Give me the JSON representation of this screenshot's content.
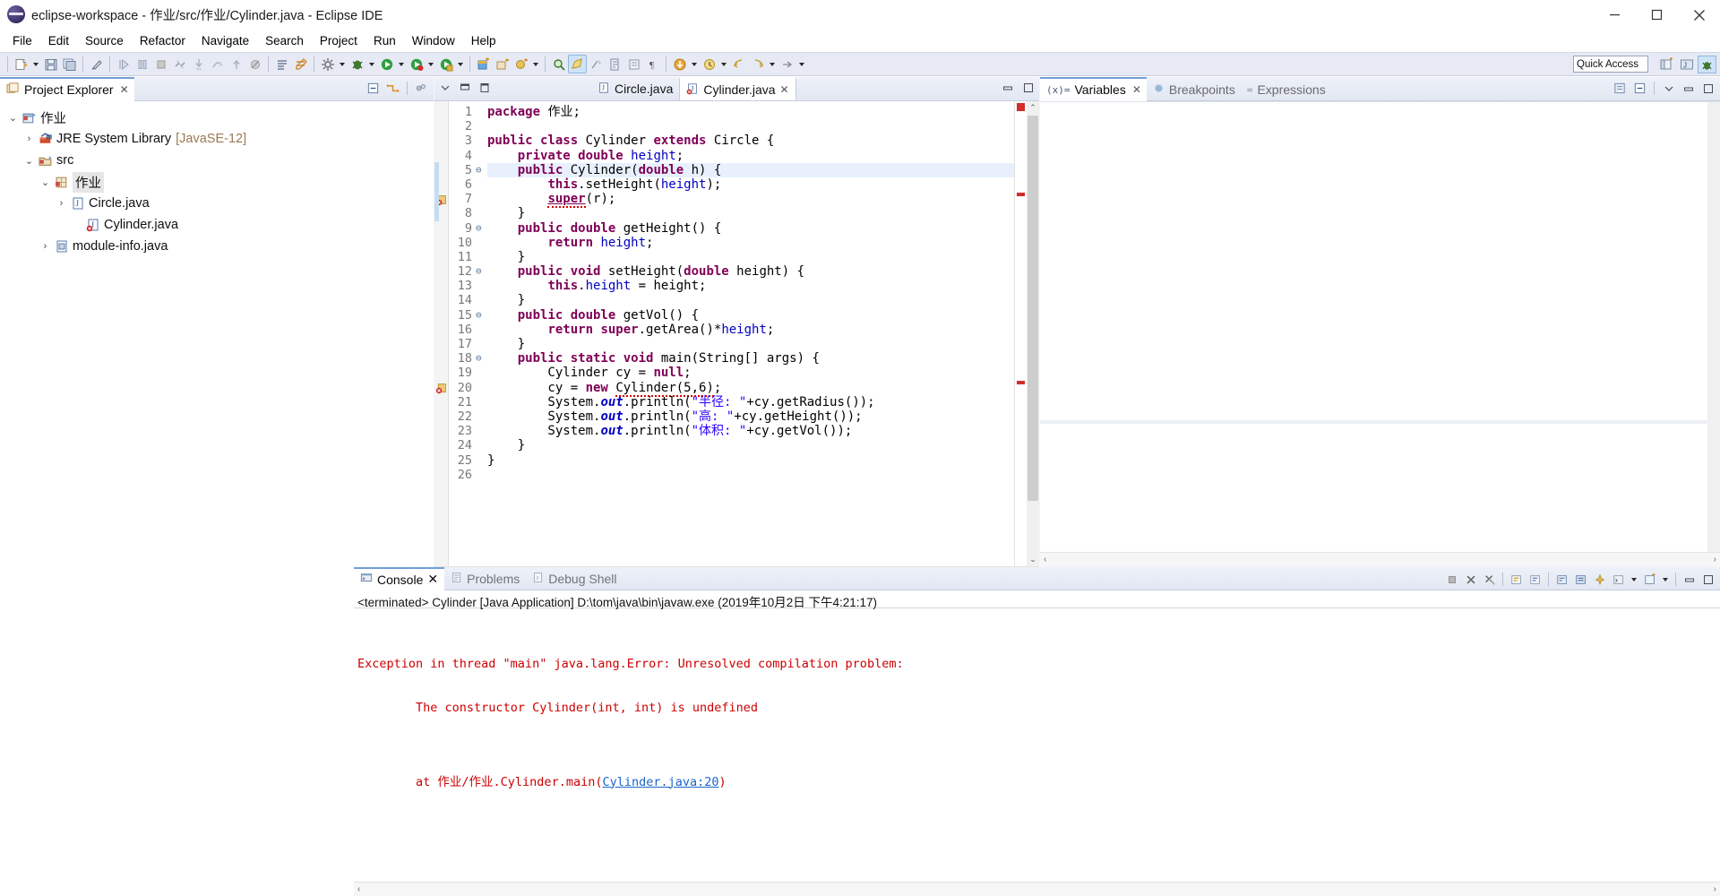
{
  "window": {
    "title": "eclipse-workspace - 作业/src/作业/Cylinder.java - Eclipse IDE",
    "app_icon": "eclipse-icon",
    "minimize_label": "–",
    "maximize_label": "□",
    "close_label": "✕"
  },
  "menubar": {
    "items": [
      {
        "label": "File"
      },
      {
        "label": "Edit"
      },
      {
        "label": "Source"
      },
      {
        "label": "Refactor"
      },
      {
        "label": "Navigate"
      },
      {
        "label": "Search"
      },
      {
        "label": "Project"
      },
      {
        "label": "Run"
      },
      {
        "label": "Window"
      },
      {
        "label": "Help"
      }
    ]
  },
  "toolbar": {
    "quick_access_value": "Quick Access",
    "icons": [
      "new-wizard-icon",
      "save-icon",
      "save-all-icon",
      "link-icon",
      "skip-breakpoints-icon",
      "resume-icon",
      "suspend-icon",
      "terminate-icon",
      "disconnect-icon",
      "step-into-icon",
      "step-over-icon",
      "step-return-icon",
      "toggle-mark-occurrences-icon",
      "open-type-icon",
      "external-tools-icon",
      "run-icon",
      "debug-icon",
      "run-last-icon",
      "new-java-project-icon",
      "new-package-icon",
      "new-class-icon",
      "search-icon",
      "java-perspective-icon",
      "annotation-icon",
      "previous-annotation-icon",
      "next-annotation-icon",
      "pilcrow-icon",
      "back-icon",
      "forward-icon",
      "last-edit-icon",
      "previous-edit-icon"
    ],
    "perspective_buttons": [
      "open-perspective-icon",
      "java-perspective-icon",
      "debug-perspective-icon"
    ]
  },
  "project_explorer": {
    "tab_label": "Project Explorer",
    "tab_icon": "project-explorer-icon",
    "close_icon": "✕",
    "tools": [
      "collapse-all-icon",
      "link-with-editor-icon",
      "view-menu-icon"
    ],
    "tree": [
      {
        "label": "作业",
        "icon": "java-project-icon",
        "twist": "⌄",
        "indent": 0,
        "decoration": "",
        "selected": false
      },
      {
        "label": "JRE System Library",
        "icon": "jre-library-icon",
        "twist": "›",
        "indent": 1,
        "decoration": "[JavaSE-12]",
        "selected": false
      },
      {
        "label": "src",
        "icon": "source-folder-icon",
        "twist": "⌄",
        "indent": 1,
        "decoration": "",
        "selected": false
      },
      {
        "label": "作业",
        "icon": "package-icon",
        "twist": "⌄",
        "indent": 2,
        "decoration": "",
        "selected": true
      },
      {
        "label": "Circle.java",
        "icon": "java-file-icon",
        "twist": "›",
        "indent": 3,
        "decoration": "",
        "selected": false
      },
      {
        "label": "Cylinder.java",
        "icon": "java-file-error-icon",
        "twist": "",
        "indent": 3,
        "decoration": "",
        "selected": false
      },
      {
        "label": "module-info.java",
        "icon": "java-module-icon",
        "twist": "›",
        "indent": 2,
        "decoration": "",
        "selected": false
      }
    ]
  },
  "editor": {
    "tools": [
      "view-menu-icon",
      "minimize-icon",
      "maximize-icon"
    ],
    "tabs": [
      {
        "label": "Circle.java",
        "icon": "java-file-icon",
        "active": false,
        "close_icon": ""
      },
      {
        "label": "Cylinder.java",
        "icon": "java-file-error-icon",
        "active": true,
        "close_icon": "✕"
      }
    ],
    "minimize_icon": "minimize-icon",
    "maximize_icon": "maximize-icon",
    "current_line": 5,
    "error_lines": [
      7,
      20
    ],
    "lines": [
      {
        "n": "1",
        "fold": "",
        "html": "<span class=\"k\">package</span> 作业;"
      },
      {
        "n": "2",
        "fold": "",
        "html": ""
      },
      {
        "n": "3",
        "fold": "",
        "html": "<span class=\"k\">public class</span> Cylinder <span class=\"k\">extends</span> Circle {"
      },
      {
        "n": "4",
        "fold": "",
        "html": "    <span class=\"k\">private double</span> <span class=\"f\">height</span>;"
      },
      {
        "n": "5",
        "fold": "⊖",
        "html": "    <span class=\"k\">public</span> Cylinder(<span class=\"k\">double</span> h) {"
      },
      {
        "n": "6",
        "fold": "",
        "html": "        <span class=\"k\">this</span>.setHeight(<span class=\"f\">height</span>);"
      },
      {
        "n": "7",
        "fold": "",
        "html": "        <span class=\"sup err-squig\">super</span>(r);"
      },
      {
        "n": "8",
        "fold": "",
        "html": "    }"
      },
      {
        "n": "9",
        "fold": "⊖",
        "html": "    <span class=\"k\">public double</span> getHeight() {"
      },
      {
        "n": "10",
        "fold": "",
        "html": "        <span class=\"k\">return</span> <span class=\"f\">height</span>;"
      },
      {
        "n": "11",
        "fold": "",
        "html": "    }"
      },
      {
        "n": "12",
        "fold": "⊖",
        "html": "    <span class=\"k\">public void</span> setHeight(<span class=\"k\">double</span> height) {"
      },
      {
        "n": "13",
        "fold": "",
        "html": "        <span class=\"k\">this</span>.<span class=\"f\">height</span> = height;"
      },
      {
        "n": "14",
        "fold": "",
        "html": "    }"
      },
      {
        "n": "15",
        "fold": "⊖",
        "html": "    <span class=\"k\">public double</span> getVol() {"
      },
      {
        "n": "16",
        "fold": "",
        "html": "        <span class=\"k\">return super</span>.getArea()*<span class=\"f\">height</span>;"
      },
      {
        "n": "17",
        "fold": "",
        "html": "    }"
      },
      {
        "n": "18",
        "fold": "⊖",
        "html": "    <span class=\"k\">public static void</span> main(String[] args) {"
      },
      {
        "n": "19",
        "fold": "",
        "html": "        Cylinder cy = <span class=\"k\">null</span>;"
      },
      {
        "n": "20",
        "fold": "",
        "html": "        cy = <span class=\"k\">new</span> <span class=\"err-squig\">Cylinder(5,6)</span>;"
      },
      {
        "n": "21",
        "fold": "",
        "html": "        System.<span class=\"st\">out</span>.println(<span class=\"s\">\"半径: \"</span>+cy.getRadius());"
      },
      {
        "n": "22",
        "fold": "",
        "html": "        System.<span class=\"st\">out</span>.println(<span class=\"s\">\"高: \"</span>+cy.getHeight());"
      },
      {
        "n": "23",
        "fold": "",
        "html": "        System.<span class=\"st\">out</span>.println(<span class=\"s\">\"体积: \"</span>+cy.getVol());"
      },
      {
        "n": "24",
        "fold": "",
        "html": "    }"
      },
      {
        "n": "25",
        "fold": "",
        "html": "}"
      },
      {
        "n": "26",
        "fold": "",
        "html": ""
      }
    ],
    "scroll_up": "⌃",
    "scroll_down": "⌄",
    "hscroll_left": "‹",
    "hscroll_right": "›"
  },
  "debug_views": {
    "tabs": [
      {
        "label": "Variables",
        "icon": "variables-icon",
        "active": true,
        "close_icon": "✕"
      },
      {
        "label": "Breakpoints",
        "icon": "breakpoints-icon",
        "active": false,
        "close_icon": ""
      },
      {
        "label": "Expressions",
        "icon": "expressions-icon",
        "active": false,
        "close_icon": ""
      }
    ],
    "tools": [
      "collapse-all-icon",
      "show-logical-structure-icon",
      "view-menu-icon",
      "minimize-icon",
      "maximize-icon"
    ],
    "hscroll_left": "‹",
    "hscroll_right": "›"
  },
  "console": {
    "tabs": [
      {
        "label": "Console",
        "icon": "console-icon",
        "active": true,
        "close_icon": "✕"
      },
      {
        "label": "Problems",
        "icon": "problems-icon",
        "active": false,
        "close_icon": ""
      },
      {
        "label": "Debug Shell",
        "icon": "debug-shell-icon",
        "active": false,
        "close_icon": ""
      }
    ],
    "tools": [
      "terminate-icon",
      "remove-launch-icon",
      "remove-all-terminated-icon",
      "previous-console-icon",
      "next-console-icon",
      "word-wrap-icon",
      "scroll-lock-icon",
      "pin-console-icon",
      "display-console-icon",
      "open-console-icon",
      "view-menu-icon",
      "minimize-icon",
      "maximize-icon"
    ],
    "launch_header": "<terminated> Cylinder [Java Application] D:\\tom\\java\\bin\\javaw.exe (2019年10月2日 下午4:21:17)",
    "output_lines": [
      {
        "text": "Exception in thread \"main\" java.lang.Error: Unresolved compilation problem: ",
        "link": false
      },
      {
        "text": "\tThe constructor Cylinder(int, int) is undefined",
        "link": false
      },
      {
        "text": "",
        "link": false
      },
      {
        "text": "\tat 作业/作业.Cylinder.main(",
        "link": false,
        "link_text": "Cylinder.java:20",
        "suffix": ")"
      }
    ],
    "hscroll_left": "‹",
    "hscroll_right": "›"
  },
  "colors": {
    "toolbar_bg": "#e7eaf4",
    "tab_active_border": "#6f9fd8",
    "keyword": "#7f0055",
    "field": "#0000c0",
    "string": "#2a00ff",
    "error_red": "#cc0000",
    "link_blue": "#1a66cc",
    "current_line": "#e8f0fe",
    "selection_gray": "#e6e6e6"
  }
}
